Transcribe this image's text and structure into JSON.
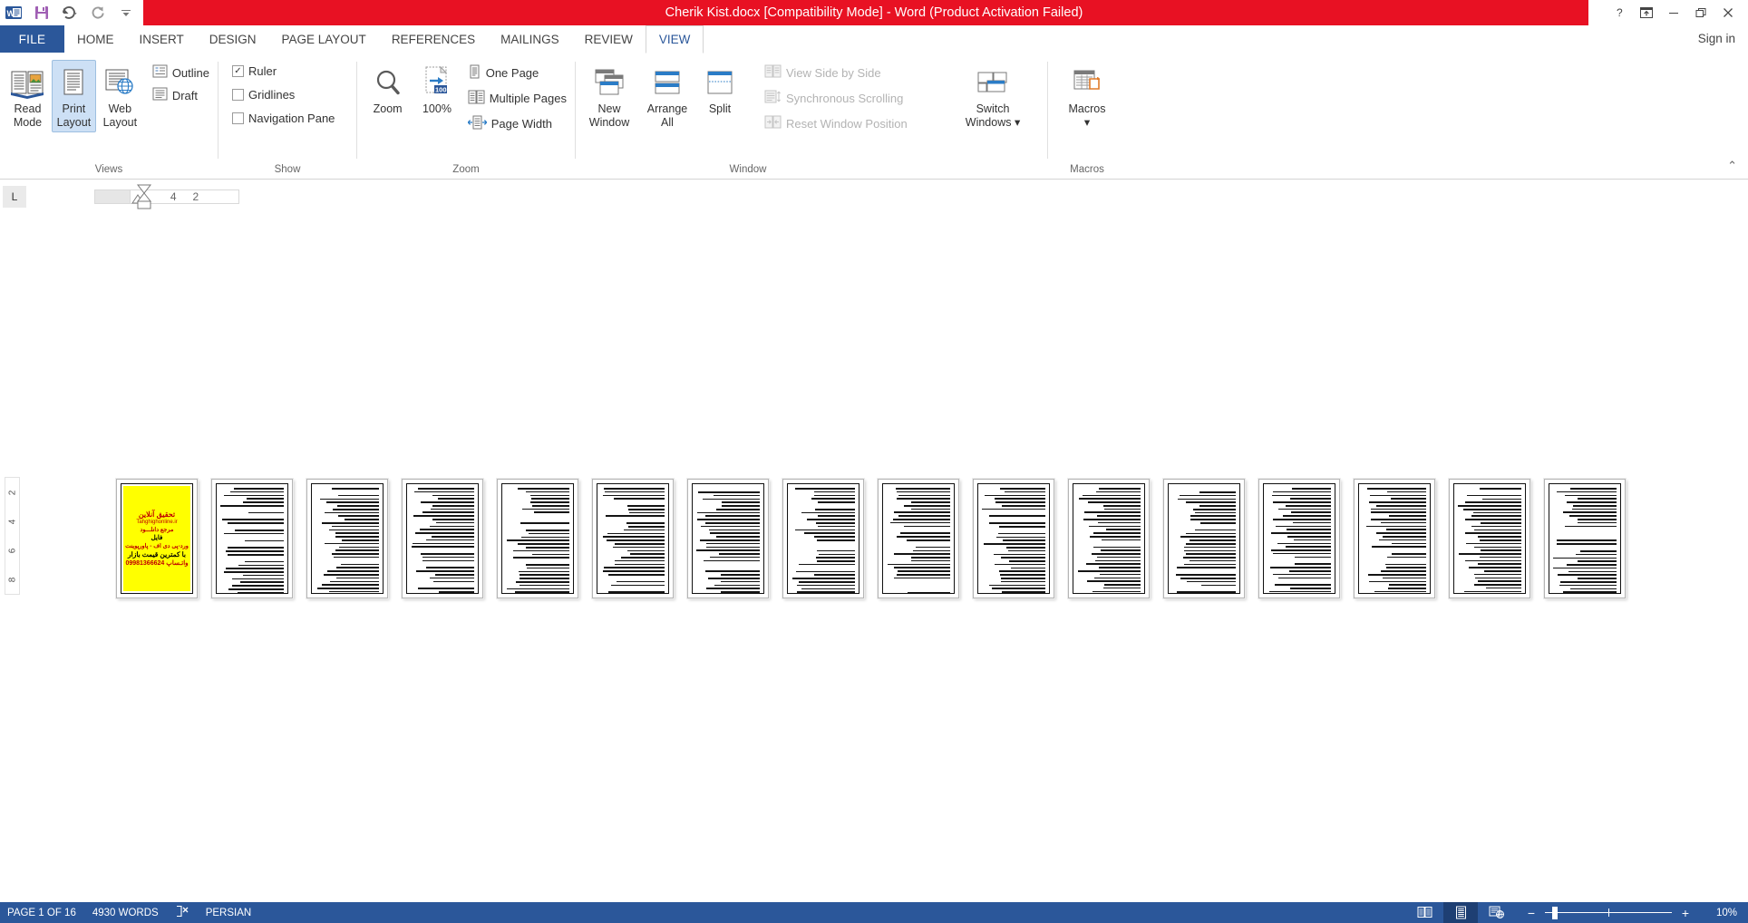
{
  "window": {
    "title": "Cherik Kist.docx [Compatibility Mode]  -  Word (Product Activation Failed)",
    "accent_red": "#e81123",
    "accent_blue": "#2b579a",
    "quick_access": [
      {
        "name": "word-logo-icon",
        "label": "W"
      },
      {
        "name": "save-icon",
        "label": "Save"
      },
      {
        "name": "undo-icon",
        "label": "Undo"
      },
      {
        "name": "redo-icon",
        "label": "Redo"
      },
      {
        "name": "customize-qat-icon",
        "label": "Customize Quick Access Toolbar"
      }
    ],
    "controls": [
      {
        "name": "help-button",
        "glyph": "?"
      },
      {
        "name": "ribbon-display-options-button",
        "glyph": "⤒"
      },
      {
        "name": "minimize-button",
        "glyph": "—"
      },
      {
        "name": "restore-button",
        "glyph": "❐"
      },
      {
        "name": "close-button",
        "glyph": "✕"
      }
    ],
    "sign_in": "Sign in"
  },
  "tabs": {
    "file": "FILE",
    "items": [
      {
        "label": "HOME",
        "active": false
      },
      {
        "label": "INSERT",
        "active": false
      },
      {
        "label": "DESIGN",
        "active": false
      },
      {
        "label": "PAGE LAYOUT",
        "active": false
      },
      {
        "label": "REFERENCES",
        "active": false
      },
      {
        "label": "MAILINGS",
        "active": false
      },
      {
        "label": "REVIEW",
        "active": false
      },
      {
        "label": "VIEW",
        "active": true
      }
    ]
  },
  "ribbon": {
    "collapse_label": "⌃",
    "groups": [
      {
        "name": "Views",
        "big_buttons": [
          {
            "label_line1": "Read",
            "label_line2": "Mode",
            "icon": "read-mode-icon",
            "selected": false
          },
          {
            "label_line1": "Print",
            "label_line2": "Layout",
            "icon": "print-layout-icon",
            "selected": true
          },
          {
            "label_line1": "Web",
            "label_line2": "Layout",
            "icon": "web-layout-icon",
            "selected": false
          }
        ],
        "small_buttons": [
          {
            "label": "Outline",
            "icon": "outline-icon",
            "disabled": false
          },
          {
            "label": "Draft",
            "icon": "draft-icon",
            "disabled": false
          }
        ]
      },
      {
        "name": "Show",
        "checkboxes": [
          {
            "label": "Ruler",
            "checked": true
          },
          {
            "label": "Gridlines",
            "checked": false
          },
          {
            "label": "Navigation Pane",
            "checked": false
          }
        ]
      },
      {
        "name": "Zoom",
        "big_buttons": [
          {
            "label_line1": "Zoom",
            "label_line2": "",
            "icon": "magnifier-icon",
            "selected": false
          },
          {
            "label_line1": "100%",
            "label_line2": "",
            "icon": "zoom-100-icon",
            "selected": false
          }
        ],
        "small_buttons": [
          {
            "label": "One Page",
            "icon": "one-page-icon",
            "disabled": false
          },
          {
            "label": "Multiple Pages",
            "icon": "multiple-pages-icon",
            "disabled": false
          },
          {
            "label": "Page Width",
            "icon": "page-width-icon",
            "disabled": false
          }
        ]
      },
      {
        "name": "Window",
        "big_buttons": [
          {
            "label_line1": "New",
            "label_line2": "Window",
            "icon": "new-window-icon",
            "selected": false
          },
          {
            "label_line1": "Arrange",
            "label_line2": "All",
            "icon": "arrange-all-icon",
            "selected": false
          },
          {
            "label_line1": "Split",
            "label_line2": "",
            "icon": "split-icon",
            "selected": false
          }
        ],
        "small_buttons": [
          {
            "label": "View Side by Side",
            "icon": "view-side-by-side-icon",
            "disabled": true
          },
          {
            "label": "Synchronous Scrolling",
            "icon": "synchronous-scrolling-icon",
            "disabled": true
          },
          {
            "label": "Reset Window Position",
            "icon": "reset-window-position-icon",
            "disabled": true
          }
        ],
        "trailing_big": [
          {
            "label_line1": "Switch",
            "label_line2": "Windows ▾",
            "icon": "switch-windows-icon",
            "selected": false
          }
        ]
      },
      {
        "name": "Macros",
        "big_buttons": [
          {
            "label_line1": "Macros",
            "label_line2": "▾",
            "icon": "macros-icon",
            "selected": false
          }
        ]
      }
    ]
  },
  "ruler": {
    "tab_selector": "L",
    "horizontal_marks": [
      "4",
      "2"
    ],
    "vertical_marks": [
      "2",
      "4",
      "6",
      "8"
    ]
  },
  "document": {
    "page_count": 16,
    "zoom_percent": "10%",
    "ad_page": {
      "line1": "تحقیق آنلاین",
      "line2": "Tahghighonline.ir",
      "line3": "مرجع دانلـــود",
      "line4": "فایل",
      "line5": "ورد-پی دی اف - پاورپوینت",
      "line6": "با کمترین قیمت بازار",
      "line7": "09981366624 واتـساپ"
    }
  },
  "status_bar": {
    "page_info": "PAGE 1 OF 16",
    "word_count": "4930 WORDS",
    "proofing_icon": "proofing-errors-icon",
    "language": "PERSIAN",
    "view_buttons": [
      {
        "name": "read-mode-view-button",
        "icon": "read-mode-icon",
        "active": false
      },
      {
        "name": "print-layout-view-button",
        "icon": "print-layout-icon",
        "active": true
      },
      {
        "name": "web-layout-view-button",
        "icon": "web-layout-icon",
        "active": false
      }
    ],
    "zoom_out": "−",
    "zoom_in": "+",
    "zoom_level": "10%"
  }
}
